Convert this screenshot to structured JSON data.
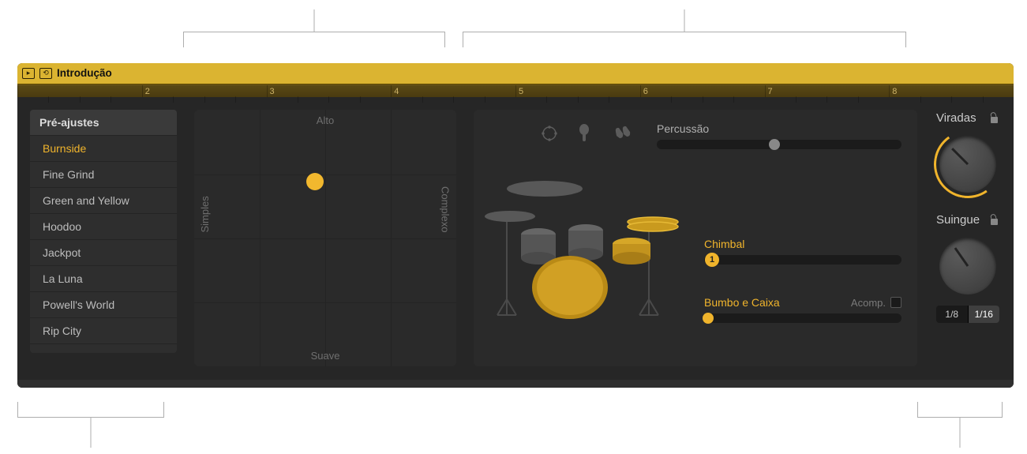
{
  "region": {
    "name": "Introdução"
  },
  "ruler": {
    "marks": [
      "2",
      "3",
      "4",
      "5",
      "6",
      "7",
      "8"
    ]
  },
  "presets": {
    "header": "Pré-ajustes",
    "items": [
      {
        "label": "Burnside",
        "selected": true
      },
      {
        "label": "Fine Grind",
        "selected": false
      },
      {
        "label": "Green and Yellow",
        "selected": false
      },
      {
        "label": "Hoodoo",
        "selected": false
      },
      {
        "label": "Jackpot",
        "selected": false
      },
      {
        "label": "La Luna",
        "selected": false
      },
      {
        "label": "Powell's World",
        "selected": false
      },
      {
        "label": "Rip City",
        "selected": false
      }
    ]
  },
  "xy": {
    "top": "Alto",
    "bottom": "Suave",
    "left": "Simples",
    "right": "Complexo"
  },
  "kit": {
    "percussion_label": "Percussão",
    "percussion_value": 0.48,
    "hihat_label": "Chimbal",
    "hihat_value": 0.04,
    "hihat_thumb_text": "1",
    "kicksnare_label": "Bumbo e Caixa",
    "kicksnare_value": 0.02,
    "acomp_label": "Acomp."
  },
  "knobs": {
    "fills_label": "Viradas",
    "swing_label": "Suingue",
    "swing_options": [
      "1/8",
      "1/16"
    ],
    "swing_selected": "1/16"
  }
}
